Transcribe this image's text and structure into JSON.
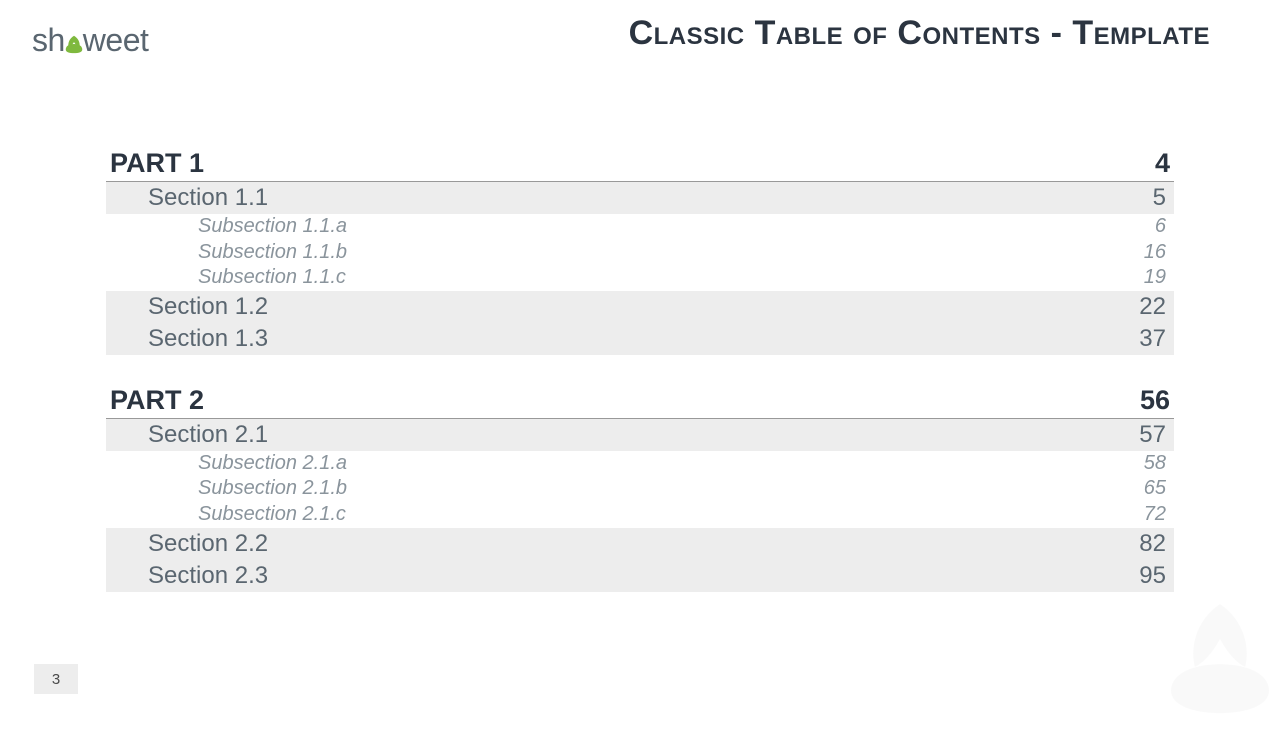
{
  "logo": {
    "part1": "sh",
    "part2": "weet"
  },
  "title": "Classic Table of Contents - Template",
  "page_number": "3",
  "toc": [
    {
      "label": "PART 1",
      "page": "4",
      "sections": [
        {
          "label": "Section 1.1",
          "page": "5",
          "subsections": [
            {
              "label": "Subsection 1.1.a",
              "page": "6"
            },
            {
              "label": "Subsection 1.1.b",
              "page": "16"
            },
            {
              "label": "Subsection 1.1.c",
              "page": "19"
            }
          ]
        },
        {
          "label": "Section 1.2",
          "page": "22",
          "subsections": []
        },
        {
          "label": "Section 1.3",
          "page": "37",
          "subsections": []
        }
      ]
    },
    {
      "label": "PART 2",
      "page": "56",
      "sections": [
        {
          "label": "Section 2.1",
          "page": "57",
          "subsections": [
            {
              "label": "Subsection 2.1.a",
              "page": "58"
            },
            {
              "label": "Subsection 2.1.b",
              "page": "65"
            },
            {
              "label": "Subsection 2.1.c",
              "page": "72"
            }
          ]
        },
        {
          "label": "Section 2.2",
          "page": "82",
          "subsections": []
        },
        {
          "label": "Section 2.3",
          "page": "95",
          "subsections": []
        }
      ]
    }
  ]
}
